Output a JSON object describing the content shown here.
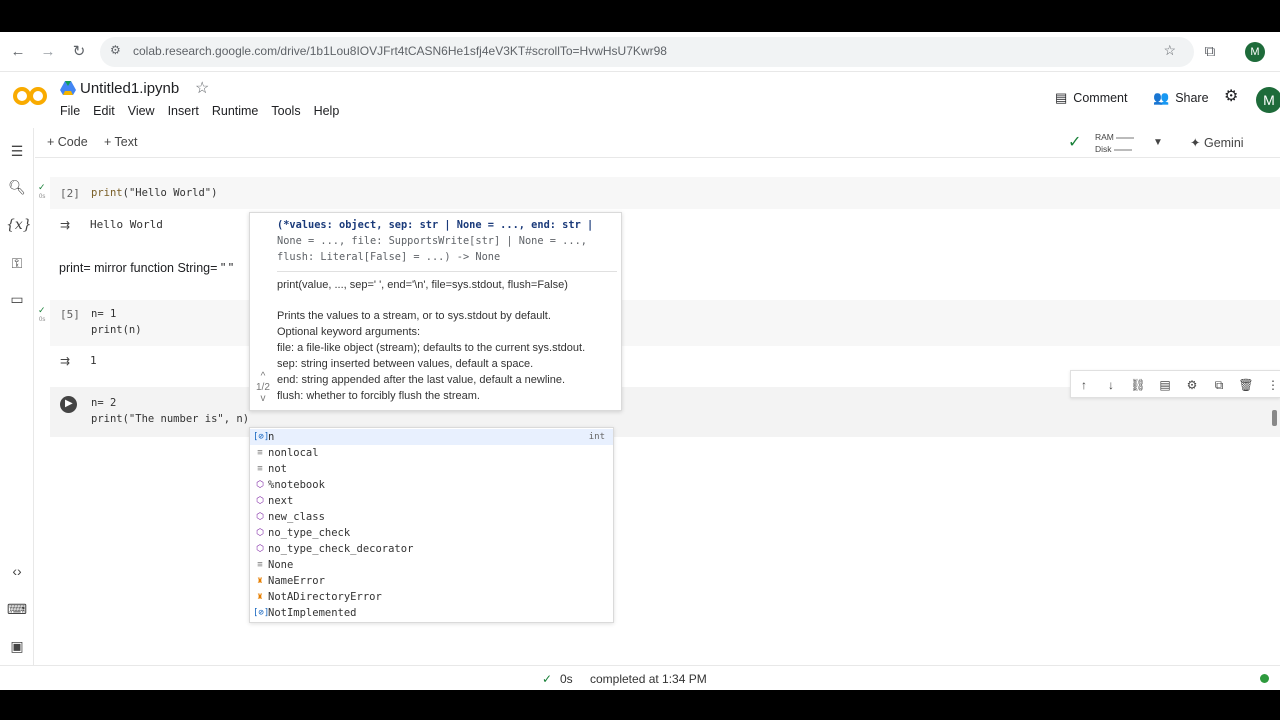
{
  "browser": {
    "url": "colab.research.google.com/drive/1b1Lou8IOVJFrt4tCASN6He1sfj4eV3KT#scrollTo=HvwHsU7Kwr98",
    "profile_initial": "M"
  },
  "header": {
    "title": "Untitled1.ipynb",
    "menu": [
      "File",
      "Edit",
      "View",
      "Insert",
      "Runtime",
      "Tools",
      "Help"
    ],
    "comment_label": "Comment",
    "share_label": "Share",
    "avatar_initial": "M"
  },
  "toolbar": {
    "add_code": "+ Code",
    "add_text": "+ Text",
    "ram_label": "RAM",
    "disk_label": "Disk",
    "gemini_label": "Gemini"
  },
  "cells": [
    {
      "count": "[2]",
      "code": "print(\"Hello World\")",
      "output": "Hello World",
      "time": "0s"
    },
    {
      "text": "print= mirror function String= \" \""
    },
    {
      "count": "[5]",
      "code_line1": "n= 1",
      "code_line2": "print(n)",
      "output": "1",
      "time": "0s"
    },
    {
      "code_line1": "n= 2",
      "code_line2": "print(\"The number is\", n)"
    }
  ],
  "tooltip": {
    "sig1": "(*values: object, sep: str | None = ..., end: str |",
    "sig2": "None = ..., file: SupportsWrite[str] | None = ...,",
    "sig3": "flush: Literal[False] = ...) -> None",
    "usage": "print(value, ..., sep=' ', end='\\n', file=sys.stdout, flush=False)",
    "doc1": "Prints the values to a stream, or to sys.stdout by default.",
    "doc2": "Optional keyword arguments:",
    "doc3": "file:  a file-like object (stream); defaults to the current sys.stdout.",
    "doc4": "sep:   string inserted between values, default a space.",
    "doc5": "end:   string appended after the last value, default a newline.",
    "doc6": "flush: whether to forcibly flush the stream.",
    "page": "1/2"
  },
  "autocomplete": [
    {
      "label": "n",
      "type": "int",
      "icon": "variable-icon"
    },
    {
      "label": "nonlocal",
      "icon": "keyword-icon"
    },
    {
      "label": "not",
      "icon": "keyword-icon"
    },
    {
      "label": "%notebook",
      "icon": "module-icon"
    },
    {
      "label": "next",
      "icon": "module-icon"
    },
    {
      "label": "new_class",
      "icon": "module-icon"
    },
    {
      "label": "no_type_check",
      "icon": "module-icon"
    },
    {
      "label": "no_type_check_decorator",
      "icon": "module-icon"
    },
    {
      "label": "None",
      "icon": "keyword-icon"
    },
    {
      "label": "NameError",
      "icon": "class-icon"
    },
    {
      "label": "NotADirectoryError",
      "icon": "class-icon"
    },
    {
      "label": "NotImplemented",
      "icon": "variable-icon"
    }
  ],
  "status": {
    "time": "0s",
    "completed": "completed at 1:34 PM"
  }
}
